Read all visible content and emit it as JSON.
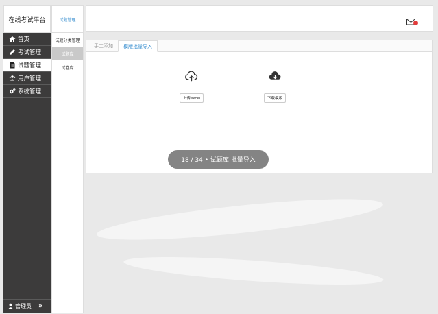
{
  "brand": {
    "title": "在线考试平台"
  },
  "sidebar": {
    "items": [
      {
        "label": "首页",
        "icon": "home-icon"
      },
      {
        "label": "考试管理",
        "icon": "pencil-icon"
      },
      {
        "label": "试题管理",
        "icon": "document-icon",
        "active": true
      },
      {
        "label": "用户管理",
        "icon": "users-icon"
      },
      {
        "label": "系统管理",
        "icon": "gears-icon"
      }
    ],
    "footer": {
      "user": "管理员",
      "expand": "»"
    }
  },
  "submenu": {
    "heading": "试题管理",
    "items": [
      {
        "label": "试题分类管理"
      },
      {
        "label": "试题库",
        "active": true
      },
      {
        "label": "试卷库"
      }
    ]
  },
  "topbar": {
    "mail_icon": "mail-icon",
    "badge_color": "#e23b3b"
  },
  "main": {
    "tabs": [
      {
        "label": "手工添加"
      },
      {
        "label": "模版批量导入",
        "active": true
      }
    ],
    "upload": {
      "icon": "cloud-upload-icon",
      "button": "上传excel"
    },
    "download": {
      "icon": "cloud-download-icon",
      "button": "下载模版"
    }
  },
  "overlay": {
    "text": "18 / 34 • 试题库 批量导入"
  },
  "colors": {
    "sidebar_bg": "#3c3b3b",
    "accent": "#3a8fd0"
  }
}
